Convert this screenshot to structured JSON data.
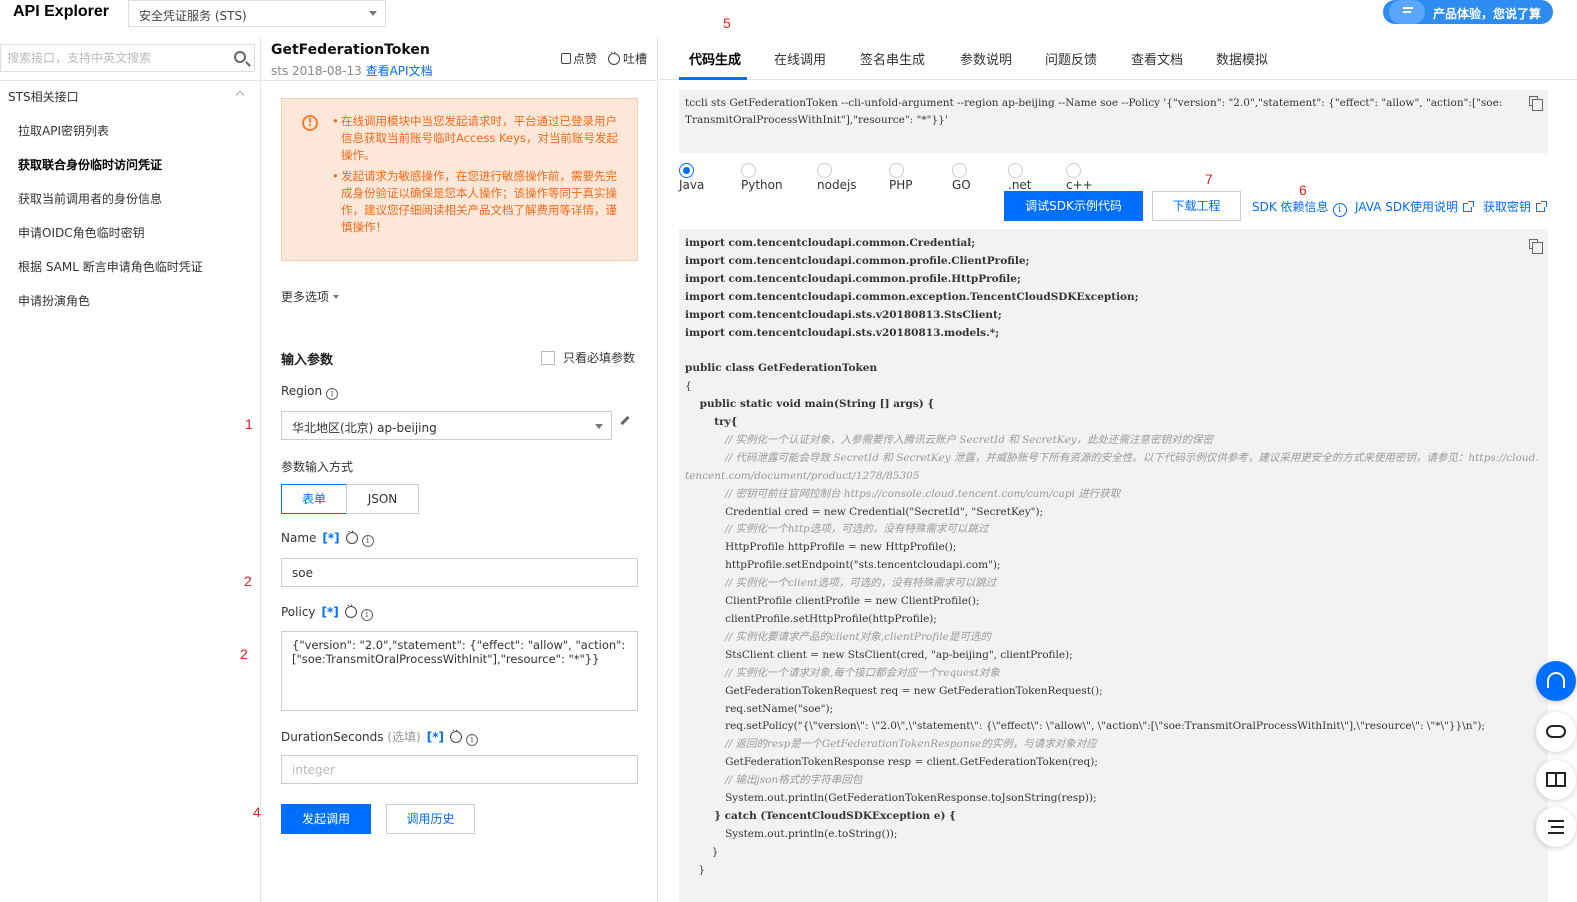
{
  "header": {
    "app_title": "API Explorer",
    "service": "安全凭证服务 (STS)",
    "promo": "产品体验，您说了算"
  },
  "sidebar": {
    "search_placeholder": "搜索接口，支持中英文搜索",
    "group": "STS相关接口",
    "items": [
      {
        "label": "拉取API密钥列表",
        "active": false
      },
      {
        "label": "获取联合身份临时访问凭证",
        "active": true
      },
      {
        "label": "获取当前调用者的身份信息",
        "active": false
      },
      {
        "label": "申请OIDC角色临时密钥",
        "active": false
      },
      {
        "label": "根据 SAML 断言申请角色临时凭证",
        "active": false
      },
      {
        "label": "申请扮演角色",
        "active": false
      }
    ]
  },
  "api": {
    "name": "GetFederationToken",
    "version_prefix": "sts 2018-08-13",
    "doc_link": "查看API文档",
    "like": "点赞",
    "feedback": "吐槽"
  },
  "notice": {
    "items": [
      "在线调用模块中当您发起请求时，平台通过已登录用户信息获取当前账号临时Access Keys，对当前账号发起操作。",
      "发起请求为敏感操作，在您进行敏感操作前，需要先完成身份验证以确保是您本人操作；该操作等同于真实操作，建议您仔细阅读相关产品文档了解费用等详情，谨慎操作！"
    ]
  },
  "form": {
    "more_options": "更多选项",
    "input_params_title": "输入参数",
    "required_only": "只看必填参数",
    "region_label": "Region",
    "region_value": "华北地区(北京) ap-beijing",
    "input_mode_label": "参数输入方式",
    "mode_form": "表单",
    "mode_json": "JSON",
    "name_label": "Name",
    "required_tag": "[*]",
    "name_value": "soe",
    "policy_label": "Policy",
    "policy_value": "{\"version\": \"2.0\",\"statement\": {\"effect\": \"allow\", \"action\": [\"soe:TransmitOralProcessWithInit\"],\"resource\": \"*\"}}",
    "duration_label": "DurationSeconds",
    "duration_optional": "(选填)",
    "duration_placeholder": "integer",
    "invoke_button": "发起调用",
    "history_button": "调用历史"
  },
  "annotations": {
    "a1": "1",
    "a2a": "2",
    "a2b": "2",
    "a4": "4",
    "a5": "5",
    "a6": "6",
    "a7": "7"
  },
  "right": {
    "tabs": [
      "代码生成",
      "在线调用",
      "签名串生成",
      "参数说明",
      "问题反馈",
      "查看文档",
      "数据模拟"
    ],
    "active_tab": 0,
    "cli": "tccli sts GetFederationToken --cli-unfold-argument --region ap-beijing --Name soe --Policy '{\"version\": \"2.0\",\"statement\": {\"effect\": \"allow\", \"action\":[\"soe:TransmitOralProcessWithInit\"],\"resource\": \"*\"}}'",
    "languages": [
      "Java",
      "Python",
      "nodejs",
      "PHP",
      "GO",
      ".net",
      "c++"
    ],
    "selected_language": "Java",
    "debug_button": "调试SDK示例代码",
    "download_button": "下载工程",
    "sdk_deps": "SDK 依赖信息",
    "java_sdk_doc": "JAVA SDK使用说明",
    "get_key": "获取密钥",
    "code_lines": [
      "import com.tencentcloudapi.common.Credential;",
      "import com.tencentcloudapi.common.profile.ClientProfile;",
      "import com.tencentcloudapi.common.profile.HttpProfile;",
      "import com.tencentcloudapi.common.exception.TencentCloudSDKException;",
      "import com.tencentcloudapi.sts.v20180813.StsClient;",
      "import com.tencentcloudapi.sts.v20180813.models.*;",
      "",
      "public class GetFederationToken",
      "{",
      "    public static void main(String [] args) {",
      "        try{",
      "            // 实例化一个认证对象，入参需要传入腾讯云账户 SecretId 和 SecretKey，此处还需注意密钥对的保密",
      "            // 代码泄露可能会导致 SecretId 和 SecretKey 泄露，并威胁账号下所有资源的安全性。以下代码示例仅供参考，建议采用更安全的方式来使用密钥，请参见：https://cloud.tencent.com/document/product/1278/85305",
      "            // 密钥可前往官网控制台 https://console.cloud.tencent.com/cam/capi 进行获取",
      "            Credential cred = new Credential(\"SecretId\", \"SecretKey\");",
      "            // 实例化一个http选项，可选的，没有特殊需求可以跳过",
      "            HttpProfile httpProfile = new HttpProfile();",
      "            httpProfile.setEndpoint(\"sts.tencentcloudapi.com\");",
      "            // 实例化一个client选项，可选的，没有特殊需求可以跳过",
      "            ClientProfile clientProfile = new ClientProfile();",
      "            clientProfile.setHttpProfile(httpProfile);",
      "            // 实例化要请求产品的client对象,clientProfile是可选的",
      "            StsClient client = new StsClient(cred, \"ap-beijing\", clientProfile);",
      "            // 实例化一个请求对象,每个接口都会对应一个request对象",
      "            GetFederationTokenRequest req = new GetFederationTokenRequest();",
      "            req.setName(\"soe\");",
      "            req.setPolicy(\"{\\\"version\\\": \\\"2.0\\\",\\\"statement\\\": {\\\"effect\\\": \\\"allow\\\", \\\"action\\\":[\\\"soe:TransmitOralProcessWithInit\\\"],\\\"resource\\\": \\\"*\\\"}}\\n\");",
      "            // 返回的resp是一个GetFederationTokenResponse的实例，与请求对象对应",
      "            GetFederationTokenResponse resp = client.GetFederationToken(req);",
      "            // 输出json格式的字符串回包",
      "            System.out.println(GetFederationTokenResponse.toJsonString(resp));",
      "        } catch (TencentCloudSDKException e) {",
      "            System.out.println(e.toString());",
      "        }",
      "    }"
    ]
  },
  "colors": {
    "accent": "#006eff",
    "annotation": "#e02020",
    "notice_bg": "#fde7d8",
    "notice_text": "#f26b1d"
  }
}
